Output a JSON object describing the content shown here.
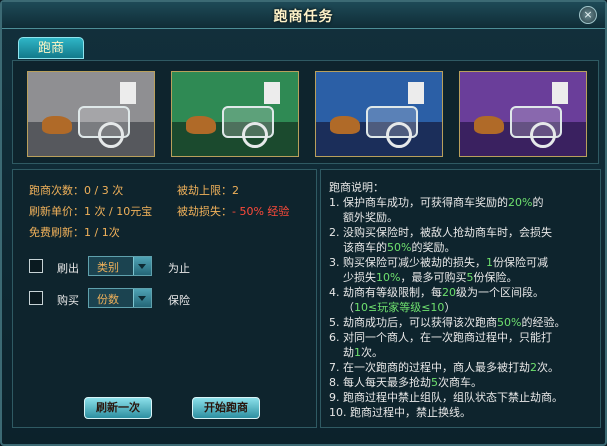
{
  "window": {
    "title": "跑商任务",
    "close_label": "×"
  },
  "tab": {
    "label": "跑商"
  },
  "cards": [
    {
      "sky": "#8f8f92",
      "ground": "#56585d"
    },
    {
      "sky": "#2f8a54",
      "ground": "#1b4a2e"
    },
    {
      "sky": "#2b5fa6",
      "ground": "#1b2e5a"
    },
    {
      "sky": "#6a3e9a",
      "ground": "#3a2160"
    }
  ],
  "stats": {
    "count_label": "跑商次数：",
    "count_value": "0 / 3 次",
    "price_label": "刷新单价：",
    "price_value": "1 次 / 10元宝",
    "free_label": "免费刷新：",
    "free_value": "1 / 1次",
    "rob_limit_label": "被劫上限：",
    "rob_limit_value": "2",
    "rob_loss_label": "被劫损失：",
    "rob_loss_value": "- 50% 经验"
  },
  "options": {
    "refresh_label": "刷出",
    "refresh_select": "类别",
    "refresh_suffix": "为止",
    "buy_label": "购买",
    "buy_select": "份数",
    "buy_suffix": "保险"
  },
  "buttons": {
    "refresh": "刷新一次",
    "start": "开始跑商"
  },
  "notes": {
    "title": "跑商说明：",
    "lines": [
      [
        "1. 保护商车成功，可获得商车奖励的",
        "20%",
        "的"
      ],
      [
        "额外奖励。"
      ],
      [
        "2. 没购买保险时，被敌人抢劫商车时，会损失"
      ],
      [
        "该商车的",
        "50%",
        "的奖励。"
      ],
      [
        "3. 购买保险可减少被劫的损失，",
        "1",
        "份保险可减"
      ],
      [
        "少损失",
        "10%",
        "，最多可购买",
        "5",
        "份保险。"
      ],
      [
        "4. 劫商有等级限制，每",
        "20",
        "级为一个区间段。"
      ],
      [
        "（",
        "10≤玩家等级≤10",
        "）"
      ],
      [
        "5. 劫商成功后，可以获得该次跑商",
        "50%",
        "的经验。"
      ],
      [
        "6. 对同一个商人，在一次跑商过程中，只能打"
      ],
      [
        "劫",
        "1",
        "次。"
      ],
      [
        "7. 在一次跑商的过程中，商人最多被打劫",
        "2",
        "次。"
      ],
      [
        "8. 每人每天最多抢劫",
        "5",
        "次商车。"
      ],
      [
        "9. 跑商过程中禁止组队，组队状态下禁止劫商。"
      ],
      [
        "10. 跑商过程中，禁止换线。"
      ]
    ]
  }
}
